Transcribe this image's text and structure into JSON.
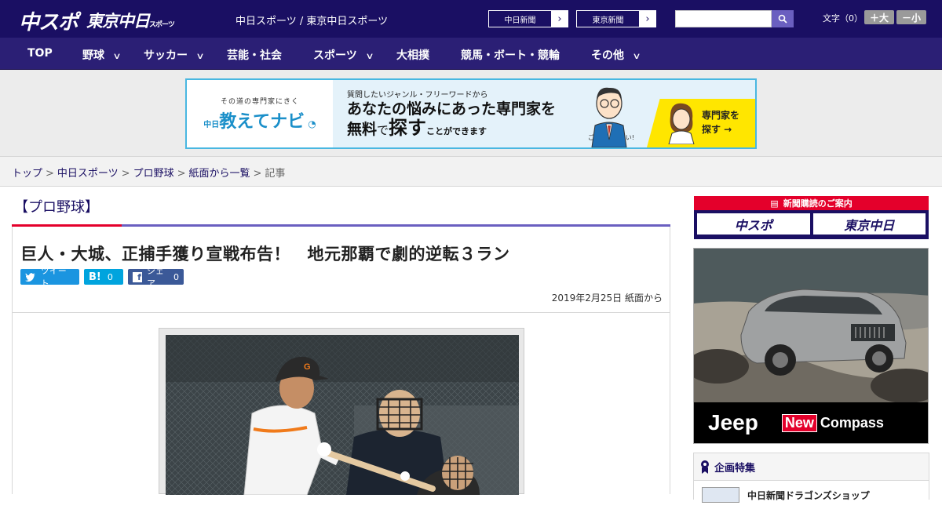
{
  "header": {
    "logo_primary": "中スポ",
    "logo_secondary": "東京中日",
    "logo_secondary_suffix": "スポーツ",
    "site_name": "中日スポーツ / 東京中日スポーツ",
    "ext_links": [
      {
        "label": "中日新聞"
      },
      {
        "label": "東京新聞"
      }
    ],
    "search": {
      "placeholder": "",
      "value": ""
    },
    "font_size": {
      "label": "文字（0）",
      "larger": "＋大",
      "smaller": "－小"
    }
  },
  "nav": {
    "items": [
      {
        "label": "TOP",
        "dropdown": false
      },
      {
        "label": "野球",
        "dropdown": true
      },
      {
        "label": "サッカー",
        "dropdown": true
      },
      {
        "label": "芸能・社会",
        "dropdown": false
      },
      {
        "label": "スポーツ",
        "dropdown": true
      },
      {
        "label": "大相撲",
        "dropdown": false
      },
      {
        "label": "競馬・ボート・競輪",
        "dropdown": false
      },
      {
        "label": "その他",
        "dropdown": true
      }
    ]
  },
  "ad_banner": {
    "tagline": "その道の専門家にきく",
    "brand_prefix": "中日",
    "brand": "教えてナビ",
    "question": "質問したいジャンル・フリーワードから",
    "headline_1": "あなたの悩みにあった専門家を",
    "headline_2_a": "無料",
    "headline_2_b": "で",
    "headline_2_c": "探す",
    "headline_2_d": "ことができます",
    "note_1": "お気軽に",
    "note_2": "ご質問ください!",
    "cta_1": "専門家を",
    "cta_2": "探す →"
  },
  "breadcrumb": {
    "items": [
      "トップ",
      "中日スポーツ",
      "プロ野球",
      "紙面から一覧"
    ],
    "current": "記事",
    "separator": ">"
  },
  "article": {
    "category": "【プロ野球】",
    "title": "巨人・大城、正捕手獲り宣戦布告！　地元那覇で劇的逆転３ラン",
    "share": {
      "tweet": "ツイート",
      "hatena": "B!",
      "hatena_count": "0",
      "facebook": "シェア",
      "facebook_count": "0"
    },
    "date": "2019年2月25日 紙面から"
  },
  "sidebar": {
    "subscribe_header": "新聞購読のご案内",
    "subscribe_logos": [
      "中スポ",
      "東京中日"
    ],
    "ad": {
      "brand": "Jeep",
      "new_label": "New",
      "model": "Compass"
    },
    "feature": {
      "title": "企画特集",
      "first_item": "中日新聞ドラゴンズショップ"
    }
  },
  "colors": {
    "header_bg": "#1a0f63",
    "nav_bg": "#2b1f75",
    "accent_red": "#e4002b",
    "accent_purple": "#6a5fc0",
    "twitter": "#1b95e0",
    "hatena": "#00a4de",
    "facebook": "#3b5998"
  }
}
